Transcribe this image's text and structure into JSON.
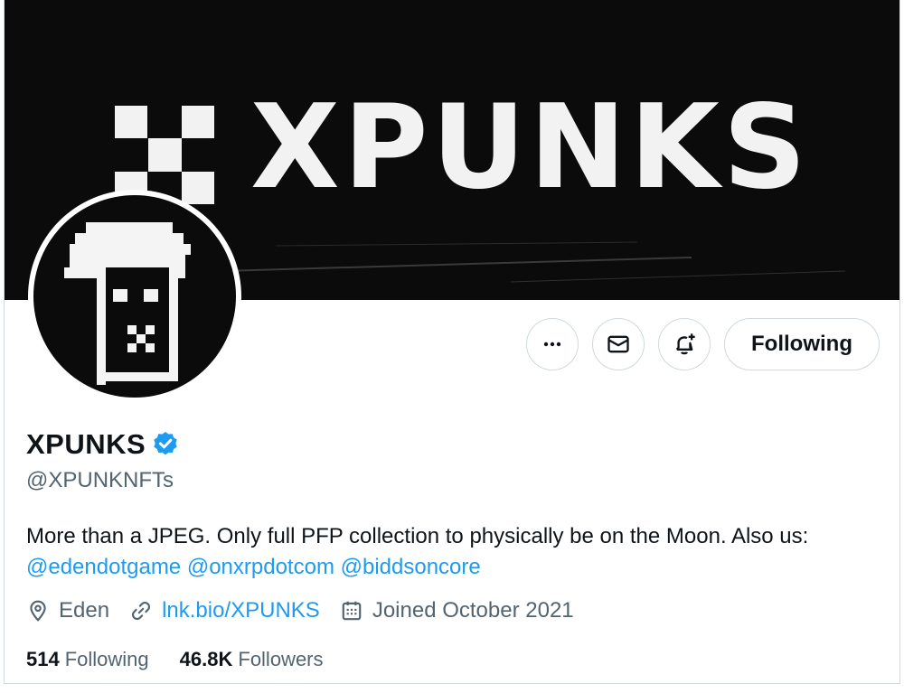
{
  "banner": {
    "text": "XPUNKS"
  },
  "profile": {
    "display_name": "XPUNKS",
    "verified_icon": "verified-badge-icon",
    "handle": "@XPUNKNFTs",
    "bio_text": "More than a JPEG. Only full PFP collection to physically be on the Moon. Also us:",
    "bio_mentions": [
      "@edendotgame",
      "@onxrpdotcom",
      "@biddsoncore"
    ],
    "location": "Eden",
    "website": "lnk.bio/XPUNKS",
    "joined": "Joined October 2021"
  },
  "actions": {
    "more_icon": "more-icon",
    "message_icon": "mail-icon",
    "notify_icon": "bell-plus-icon",
    "follow_label": "Following"
  },
  "stats": {
    "following_count": "514",
    "following_label": "Following",
    "followers_count": "46.8K",
    "followers_label": "Followers"
  },
  "colors": {
    "accent": "#1d9bf0",
    "secondary_text": "#536471",
    "primary_text": "#0f1419",
    "border": "#cfd9de"
  }
}
